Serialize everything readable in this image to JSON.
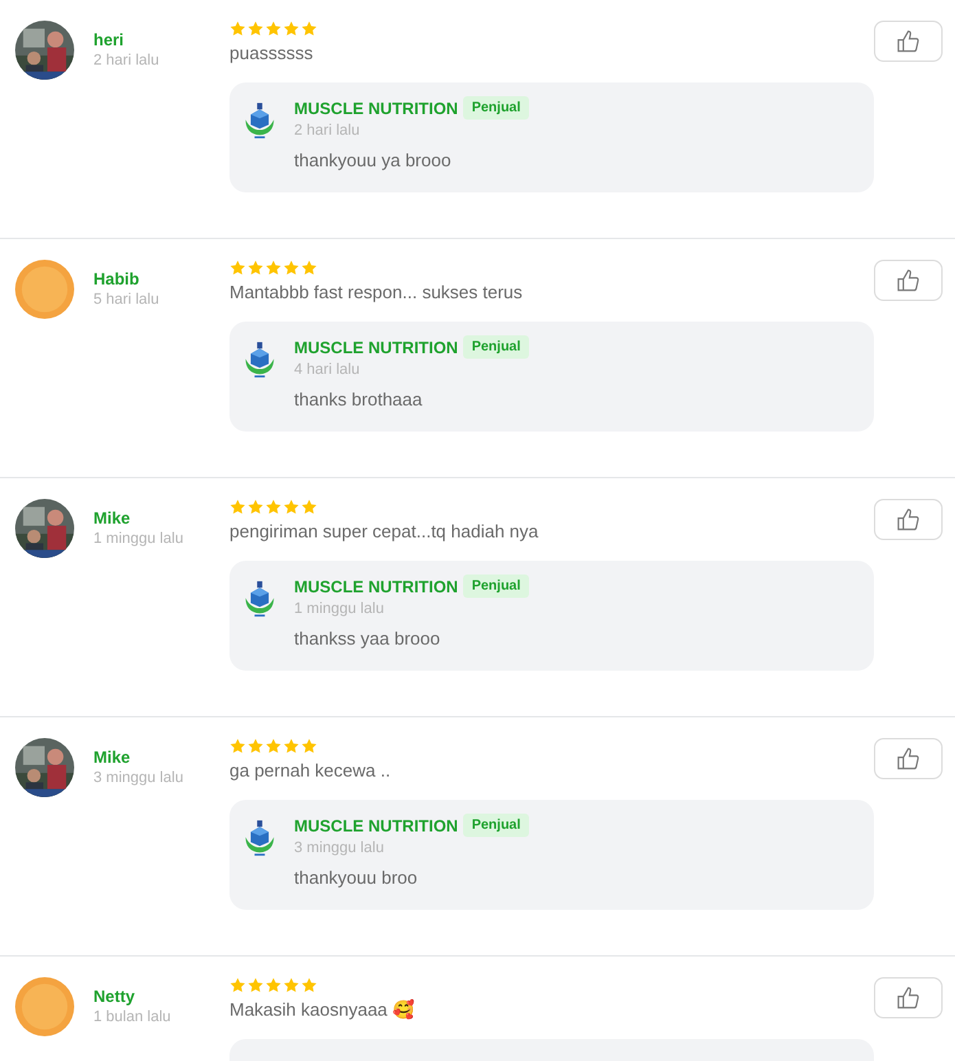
{
  "reviews": [
    {
      "name": "heri",
      "time": "2 hari lalu",
      "stars": 5,
      "text": "puassssss",
      "reply": {
        "seller": "MUSCLE NUTRITION",
        "badge": "Penjual",
        "time": "2 hari lalu",
        "text": "thankyouu ya brooo"
      }
    },
    {
      "name": "Habib",
      "time": "5 hari lalu",
      "avatar": {
        "kind": "cartoon"
      },
      "stars": 5,
      "text": "Mantabbb fast respon... sukses terus",
      "reply": {
        "seller": "MUSCLE NUTRITION",
        "badge": "Penjual",
        "time": "4 hari lalu",
        "text": "thanks brothaaa"
      }
    },
    {
      "name": "Mike",
      "time": "1 minggu lalu",
      "stars": 5,
      "text": "pengiriman super cepat...tq hadiah nya",
      "reply": {
        "seller": "MUSCLE NUTRITION",
        "badge": "Penjual",
        "time": "1 minggu lalu",
        "text": "thankss yaa brooo"
      }
    },
    {
      "name": "Mike",
      "time": "3 minggu lalu",
      "stars": 5,
      "text": "ga pernah kecewa ..",
      "reply": {
        "seller": "MUSCLE NUTRITION",
        "badge": "Penjual",
        "time": "3 minggu lalu",
        "text": "thankyouu broo"
      }
    },
    {
      "name": "Netty",
      "time": "1 bulan lalu",
      "avatar": {
        "kind": "cartoon"
      },
      "stars": 5,
      "text": "Makasih kaosnyaaa 🥰",
      "reply": {
        "kind": "cut"
      }
    }
  ]
}
